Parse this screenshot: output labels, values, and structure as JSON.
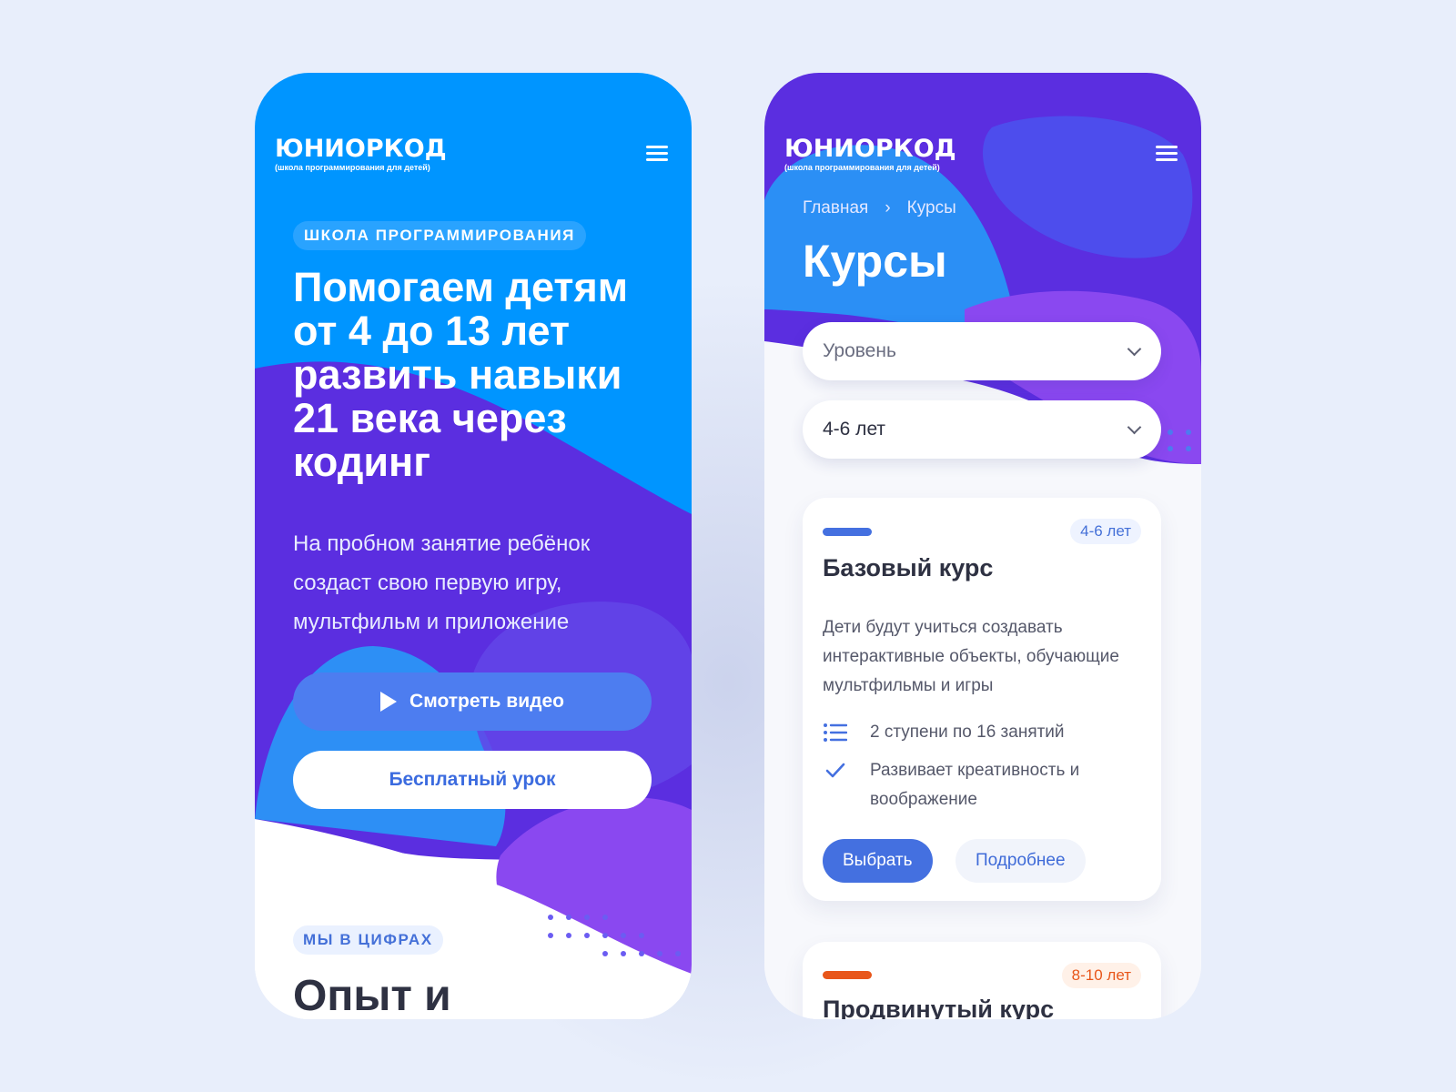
{
  "colors": {
    "background": "#e8eefb",
    "blue": "#0095ff",
    "violet": "#5b2ee0",
    "purple": "#8a48f0",
    "accent_blue": "#4470e0",
    "orange": "#e8561a"
  },
  "logo": {
    "name": "ЮНИОРКОД",
    "tagline": "(школа программирования для детей)"
  },
  "home": {
    "tag": "ШКОЛА ПРОГРАММИРОВАНИЯ",
    "headline": "Помогаем детям от 4 до 13 лет развить навыки 21 века через кодинг",
    "subtext": "На пробном занятие ребёнок создаст свою первую игру, мультфильм и приложение",
    "video_button": "Смотреть видео",
    "free_lesson_button": "Бесплатный урок",
    "stats_tag": "МЫ В ЦИФРАХ",
    "stats_title": "Опыт и"
  },
  "courses": {
    "breadcrumb": [
      "Главная",
      "Курсы"
    ],
    "title": "Курсы",
    "filters": {
      "level": "Уровень",
      "age": "4-6 лет"
    },
    "cards": [
      {
        "age": "4-6 лет",
        "title": "Базовый курс",
        "description": "Дети будут учиться создавать интерактивные объекты, обучающие мультфильмы и игры",
        "features": [
          "2 ступени по 16 занятий",
          "Развивает креативность и воображение"
        ],
        "choose_button": "Выбрать",
        "more_button": "Подробнее",
        "accent": "#4470e0"
      },
      {
        "age": "8-10 лет",
        "title": "Продвинутый курс",
        "accent": "#e8561a"
      }
    ]
  }
}
